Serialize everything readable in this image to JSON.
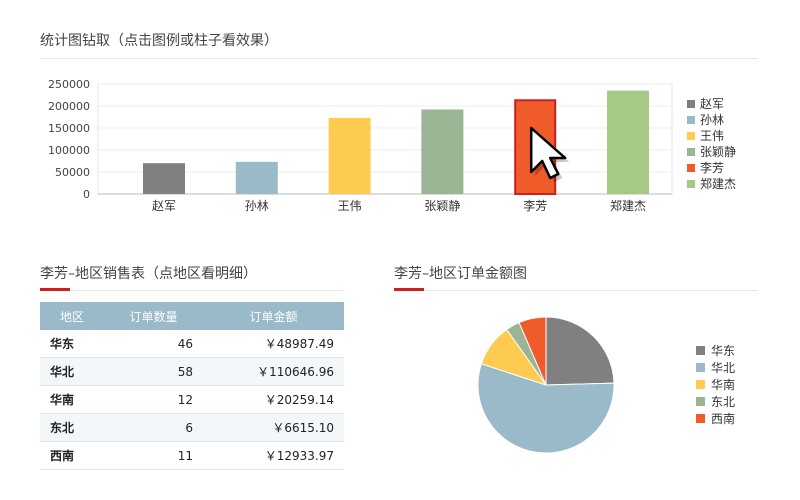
{
  "header": {
    "title": "统计图钻取（点击图例或柱子看效果）"
  },
  "bar_section": {
    "chart_data": {
      "type": "bar",
      "title": "",
      "xlabel": "",
      "ylabel": "",
      "categories": [
        "赵军",
        "孙林",
        "王伟",
        "张颖静",
        "李芳",
        "郑建杰"
      ],
      "values": [
        70000,
        73000,
        173000,
        192000,
        213000,
        235000
      ],
      "colors": [
        "#808080",
        "#9ab9c9",
        "#fccb50",
        "#9ab593",
        "#f05b2a",
        "#a6c987"
      ],
      "highlight_index": 4,
      "highlight_border": "#cc1f1f",
      "ylim": [
        0,
        250000
      ],
      "yticks": [
        0,
        50000,
        100000,
        150000,
        200000,
        250000
      ],
      "ytick_labels": [
        "0",
        "50000",
        "100000",
        "150000",
        "200000",
        "250000"
      ],
      "grid": true,
      "legend": "right"
    }
  },
  "table_section": {
    "title": "李芳–地区销售表（点地区看明细）",
    "columns": [
      "地区",
      "订单数量",
      "订单金额"
    ],
    "rows": [
      {
        "region": "华东",
        "count": "46",
        "amount": "￥48987.49"
      },
      {
        "region": "华北",
        "count": "58",
        "amount": "￥110646.96"
      },
      {
        "region": "华南",
        "count": "12",
        "amount": "￥20259.14"
      },
      {
        "region": "东北",
        "count": "6",
        "amount": "￥6615.10"
      },
      {
        "region": "西南",
        "count": "11",
        "amount": "￥12933.97"
      }
    ]
  },
  "pie_section": {
    "title": "李芳–地区订单金额图",
    "chart_data": {
      "type": "pie",
      "title": "",
      "labels": [
        "华东",
        "华北",
        "华南",
        "东北",
        "西南"
      ],
      "values": [
        48987.49,
        110646.96,
        20259.14,
        6615.1,
        12933.97
      ],
      "colors": [
        "#808080",
        "#9ab9c9",
        "#fccb50",
        "#9ab593",
        "#f05b2a"
      ],
      "legend": "right"
    }
  },
  "colors": {
    "accent": "#cc1f1f",
    "table_header": "#9ab9c9"
  }
}
